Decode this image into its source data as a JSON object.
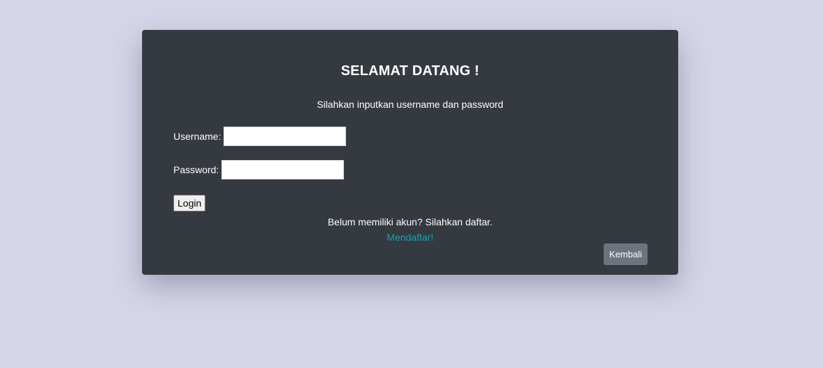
{
  "login_card": {
    "title": "SELAMAT DATANG !",
    "subtitle": "Silahkan inputkan username dan password",
    "username_label": "Username:",
    "username_value": "",
    "password_label": "Password:",
    "password_value": "",
    "login_label": "Login",
    "signup_prompt": "Belum memiliki akun? Silahkan daftar.",
    "signup_link": "Mendaftar!",
    "back_label": "Kembali"
  },
  "colors": {
    "page_background": "#d6d5e8",
    "card_background": "#353a40",
    "link": "#17a2b8",
    "back_button": "#6c757d"
  }
}
